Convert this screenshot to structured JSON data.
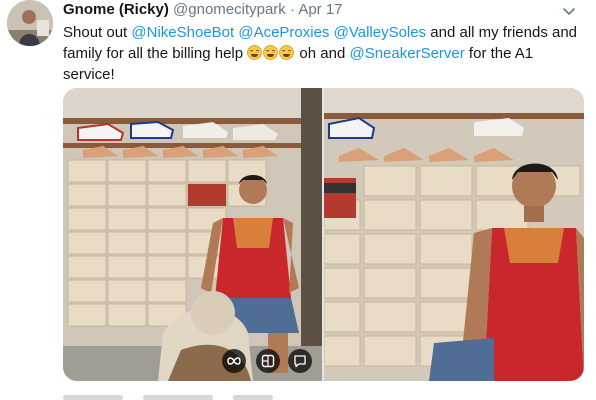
{
  "tweet": {
    "display_name": "Gnome (Ricky)",
    "handle": "@gnomecitypark",
    "separator": "·",
    "time": "Apr 17",
    "text_parts": {
      "t1": "Shout out ",
      "m1": "@NikeShoeBot",
      "s1": " ",
      "m2": "@AceProxies",
      "s2": " ",
      "m3": "@ValleySoles",
      "t2": " and all my friends and family for all the billing help ",
      "t3": " oh and ",
      "m4": "@SneakerServer",
      "t4": " for the A1 service!"
    },
    "emoji": [
      "face-with-tears-of-joy-icon",
      "face-with-tears-of-joy-icon",
      "face-with-tears-of-joy-icon"
    ]
  },
  "media": {
    "photo_count": 2,
    "left_photo": "man-with-bulldog-and-sneaker-boxes",
    "right_photo": "man-smiling-with-sneaker-boxes"
  },
  "colors": {
    "link": "#1b95e0",
    "secondary": "#657786",
    "text": "#14171a"
  }
}
